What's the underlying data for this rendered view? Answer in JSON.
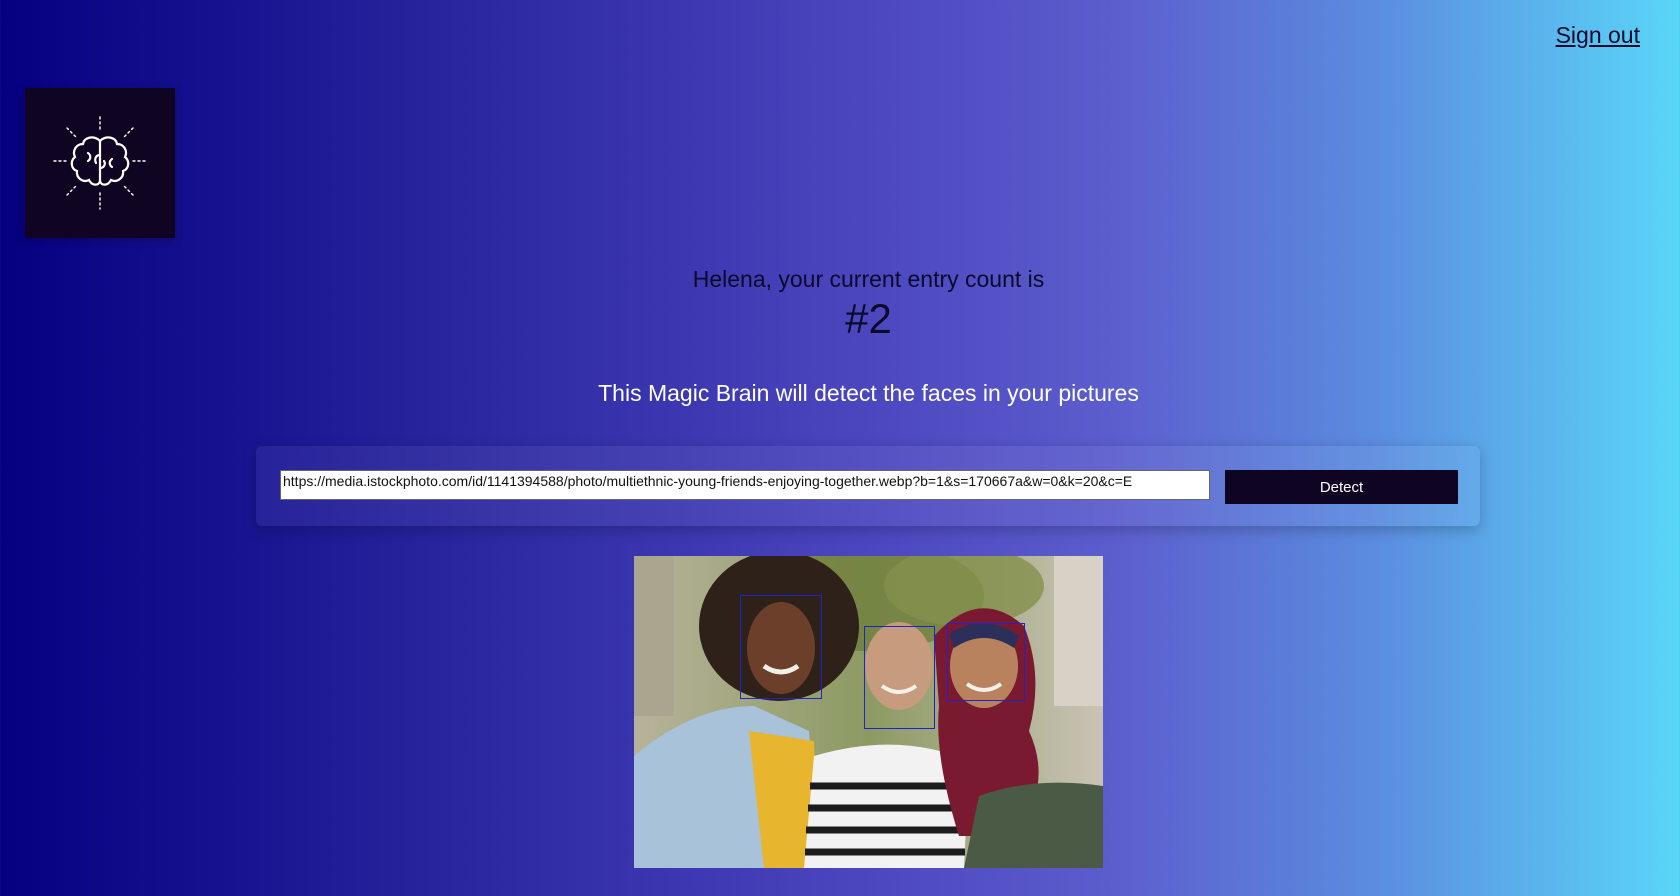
{
  "header": {
    "signout_label": "Sign out"
  },
  "logo": {
    "icon": "brain-icon"
  },
  "entry": {
    "text": "Helena, your current entry count is",
    "count": "#2"
  },
  "tagline": "This Magic Brain will detect the faces in your pictures",
  "form": {
    "url_value": "https://media.istockphoto.com/id/1141394588/photo/multiethnic-young-friends-enjoying-together.webp?b=1&s=170667a&w=0&k=20&c=E",
    "detect_label": "Detect"
  },
  "colors": {
    "gradient_start": "#050080",
    "gradient_end": "#5ad6f8",
    "button_bg": "#0f0523",
    "face_box": "#2222cc"
  }
}
